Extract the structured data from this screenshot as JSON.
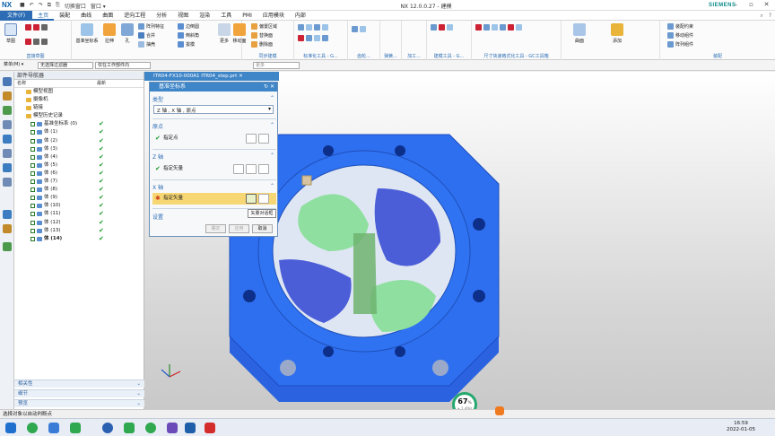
{
  "app": {
    "logo": "NX",
    "window_title": "NX 12.0.0.27 - 建模",
    "window_menu": "窗口 ▾",
    "brand": "SIEMENS",
    "switch_window": "切换窗口"
  },
  "menubar": {
    "file": "文件(F)",
    "items": [
      "主页",
      "装配",
      "曲线",
      "曲面",
      "逆向工程",
      "分析",
      "视图",
      "渲染",
      "工具",
      "PMI",
      "应用模块",
      "内部"
    ],
    "active": "主页",
    "search_hint": "查找命令"
  },
  "ribbon": {
    "sketch_label": "草图",
    "groups": [
      "直接草图",
      "特征",
      "同步建模",
      "标准化工具 - G...",
      "齿轮...",
      "弹簧...",
      "加工...",
      "建模工具 - G...",
      "尺寸快速格式化工具 - GC工具箱",
      "装配"
    ],
    "feature_buttons": [
      "基准坐标系",
      "拉伸",
      "孔"
    ],
    "feature_small": [
      "阵列特征",
      "合并",
      "抽壳",
      "边倒圆",
      "倒斜角",
      "拔模",
      "偏置区域",
      "替换面",
      "删除面"
    ],
    "more_label": "更多",
    "move_face": "移动面",
    "surface": "曲面",
    "add": "添加",
    "assembly_small": [
      "装配约束",
      "移动组件",
      "阵列组件"
    ]
  },
  "toolbar2": {
    "menu": "菜单(M) ▾",
    "filter": "无选择过滤器",
    "scope": "仅在工作部件内"
  },
  "nav": {
    "title": "部件导航器",
    "col_name": "名称",
    "col_latest": "最新",
    "items": [
      {
        "label": "模型视图",
        "indent": 1
      },
      {
        "label": "摄像机",
        "indent": 1
      },
      {
        "label": "链接",
        "indent": 1
      },
      {
        "label": "模型历史记录",
        "indent": 1
      },
      {
        "label": "基准坐标系 (0)",
        "indent": 2,
        "tick": true
      },
      {
        "label": "体 (1)",
        "indent": 2,
        "tick": true
      },
      {
        "label": "体 (2)",
        "indent": 2,
        "tick": true
      },
      {
        "label": "体 (3)",
        "indent": 2,
        "tick": true
      },
      {
        "label": "体 (4)",
        "indent": 2,
        "tick": true
      },
      {
        "label": "体 (5)",
        "indent": 2,
        "tick": true
      },
      {
        "label": "体 (6)",
        "indent": 2,
        "tick": true
      },
      {
        "label": "体 (7)",
        "indent": 2,
        "tick": true
      },
      {
        "label": "体 (8)",
        "indent": 2,
        "tick": true
      },
      {
        "label": "体 (9)",
        "indent": 2,
        "tick": true
      },
      {
        "label": "体 (10)",
        "indent": 2,
        "tick": true
      },
      {
        "label": "体 (11)",
        "indent": 2,
        "tick": true
      },
      {
        "label": "体 (12)",
        "indent": 2,
        "tick": true
      },
      {
        "label": "体 (13)",
        "indent": 2,
        "tick": true
      },
      {
        "label": "体 (14)",
        "indent": 2,
        "tick": true,
        "bold": true
      }
    ],
    "sections": [
      "相关性",
      "细节",
      "预览"
    ]
  },
  "viewport": {
    "tab": "ITR04-FX10-000A1 ITR04_step.prt ✕",
    "zoom": "67",
    "zoom_unit": "%",
    "zoom_sub": "+ 1.40/s"
  },
  "dialog": {
    "title": "基准坐标系",
    "type_label": "类型",
    "type_value": "Z 轴 , X 轴 , 原点",
    "origin_label": "原点",
    "origin_row": "指定点",
    "z_label": "Z 轴",
    "z_row": "指定矢量",
    "x_label": "X 轴",
    "x_row": "指定矢量",
    "settings": "设置",
    "ok": "确定",
    "apply": "应用",
    "cancel": "取消",
    "tooltip": "矢量对话框"
  },
  "status": {
    "text": "选择对象以自动判断点"
  },
  "clock": {
    "time": "16:59",
    "date": "2022-01-05"
  },
  "colors": {
    "accent": "#2b6cb4",
    "part_blue": "#2e6ff0",
    "face_green": "#8fe0a0",
    "face_purple": "#4b5ed8",
    "tick": "#1e9a2e",
    "highlight": "#f7d774"
  }
}
